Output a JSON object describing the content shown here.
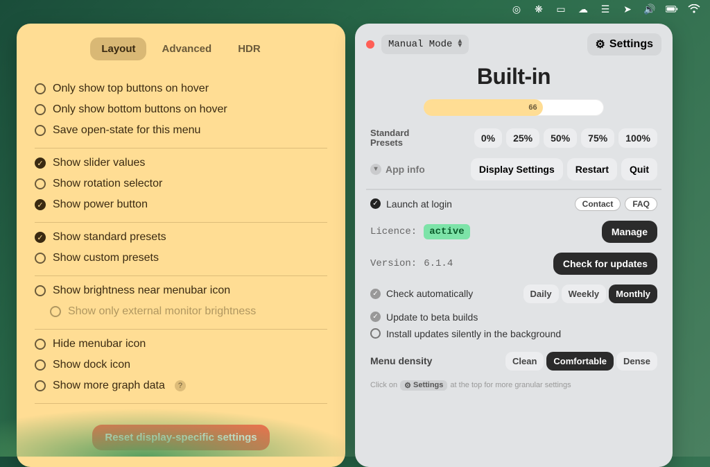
{
  "menubar_icons": [
    "dial-icon",
    "compass-icon",
    "display-icon",
    "cloud-icon",
    "drives-icon",
    "location-icon",
    "volume-icon",
    "battery-icon",
    "wifi-icon"
  ],
  "left": {
    "tabs": {
      "layout": "Layout",
      "advanced": "Advanced",
      "hdr": "HDR"
    },
    "g1": [
      {
        "label": "Only show top buttons on hover",
        "checked": false
      },
      {
        "label": "Only show bottom buttons on hover",
        "checked": false
      },
      {
        "label": "Save open-state for this menu",
        "checked": false
      }
    ],
    "g2": [
      {
        "label": "Show slider values",
        "checked": true
      },
      {
        "label": "Show rotation selector",
        "checked": false
      },
      {
        "label": "Show power button",
        "checked": true
      }
    ],
    "g3": [
      {
        "label": "Show standard presets",
        "checked": true
      },
      {
        "label": "Show custom presets",
        "checked": false
      }
    ],
    "g4": {
      "parent": "Show brightness near menubar icon",
      "child": "Show only external monitor brightness"
    },
    "g5": [
      {
        "label": "Hide menubar icon",
        "checked": false
      },
      {
        "label": "Show dock icon",
        "checked": false
      },
      {
        "label": "Show more graph data",
        "checked": false,
        "info": true
      }
    ],
    "reset": "Reset display-specific settings"
  },
  "right": {
    "mode": "Manual Mode",
    "settings_label": "Settings",
    "display": "Built-in",
    "brightness": 66,
    "presets_label1": "Standard",
    "presets_label2": "Presets",
    "presets": [
      "0%",
      "25%",
      "50%",
      "75%",
      "100%"
    ],
    "app_info": "App info",
    "display_settings": "Display Settings",
    "restart": "Restart",
    "quit": "Quit",
    "launch_login": "Launch at login",
    "contact": "Contact",
    "faq": "FAQ",
    "licence_key": "Licence:",
    "licence_val": "active",
    "manage": "Manage",
    "version_key": "Version:",
    "version_val": "6.1.4",
    "check_updates": "Check for updates",
    "check_auto": "Check automatically",
    "freq": {
      "daily": "Daily",
      "weekly": "Weekly",
      "monthly": "Monthly"
    },
    "beta": "Update to beta builds",
    "silent": "Install updates silently in the background",
    "density_label": "Menu density",
    "density": {
      "clean": "Clean",
      "comfortable": "Comfortable",
      "dense": "Dense"
    },
    "hint_pre": "Click on",
    "hint_tag": "Settings",
    "hint_post": "at the top for more granular settings"
  }
}
